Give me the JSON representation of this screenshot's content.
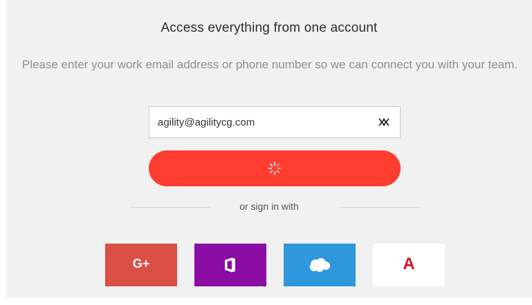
{
  "header": {
    "title": "Access everything from one account",
    "subtitle": "Please enter your work email address or phone number so we can connect you with your team."
  },
  "form": {
    "email_value": "agility@agilitycg.com",
    "clear_icon": "clear-icon",
    "submit_icon": "spinner-icon"
  },
  "divider": {
    "label": "or sign in with"
  },
  "social": [
    {
      "name": "google-plus",
      "glyph": "G+",
      "color": "#db5044"
    },
    {
      "name": "office-365",
      "icon": "office-icon",
      "color": "#8b0da3"
    },
    {
      "name": "salesforce",
      "icon": "salesforce-cloud-icon",
      "color": "#2f97db"
    },
    {
      "name": "agility",
      "glyph": "A",
      "color": "#ffffff",
      "glyph_color": "#d01427"
    }
  ],
  "colors": {
    "accent": "#ff3c30",
    "background": "#f1f1f1"
  }
}
